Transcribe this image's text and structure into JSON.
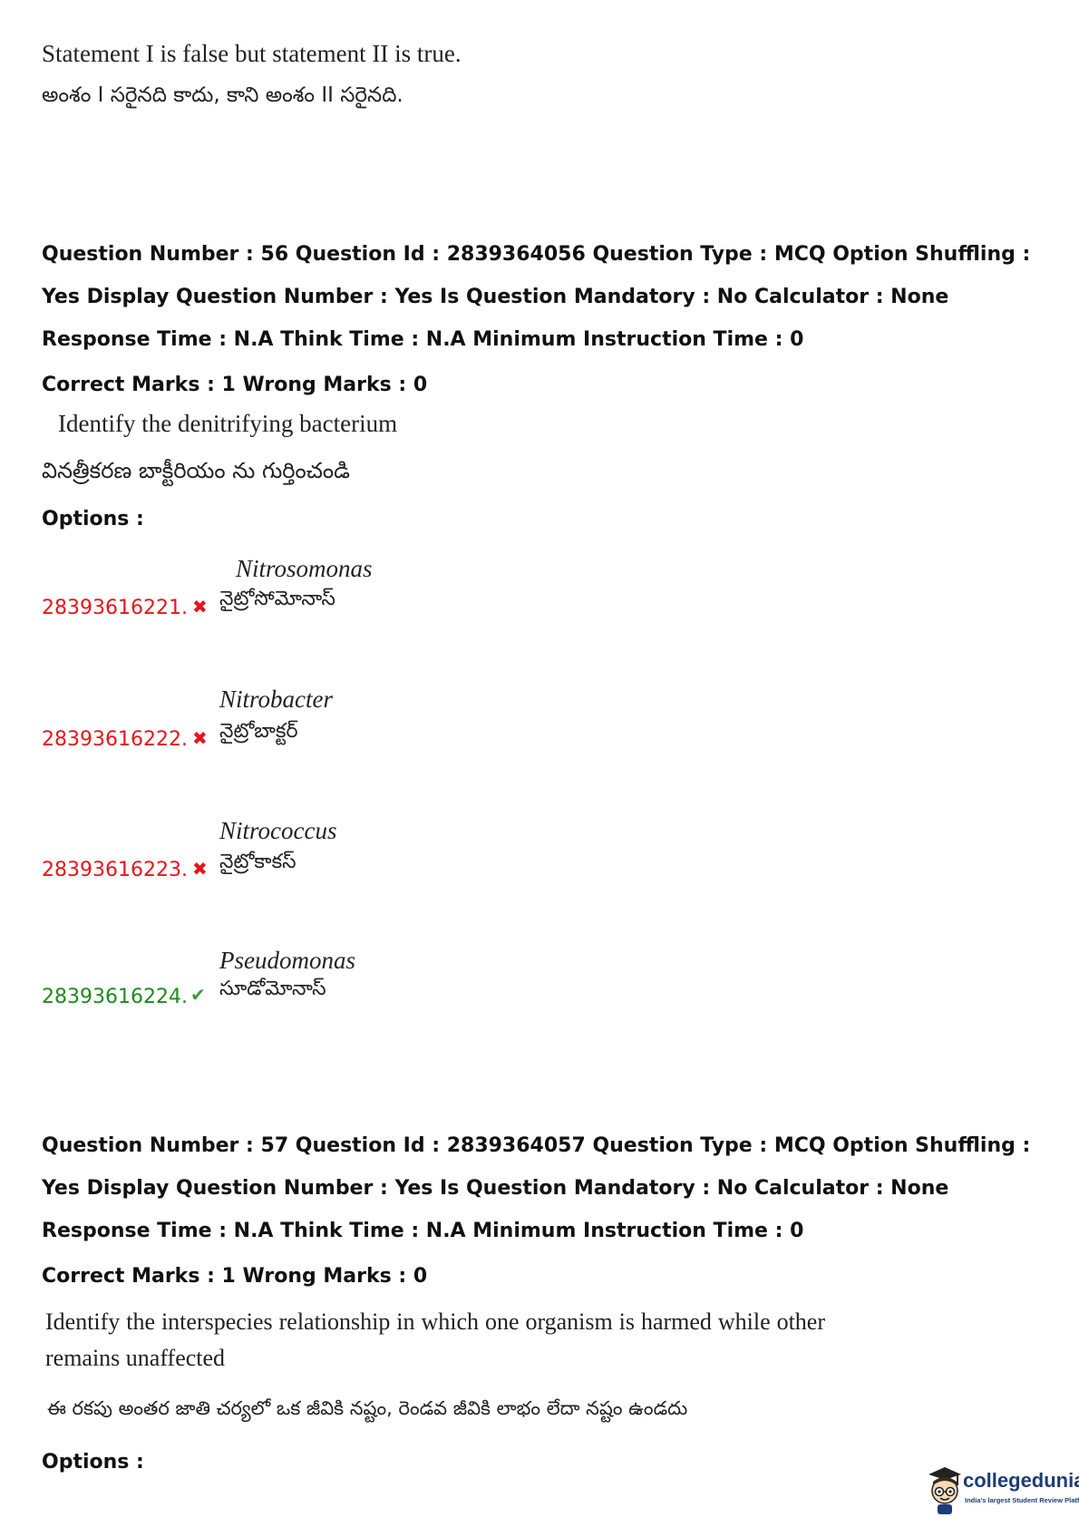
{
  "top_statement": {
    "english": "Statement I is false but statement II is true.",
    "telugu": "అంశం I సరైనది కాదు, కాని అంశం II సరైనది."
  },
  "q56": {
    "meta": "Question Number : 56 Question Id : 2839364056 Question Type : MCQ Option Shuffling : Yes Display Question Number : Yes Is Question Mandatory : No Calculator : None Response Time : N.A Think Time : N.A Minimum Instruction Time : 0",
    "marks": "Correct Marks : 1 Wrong Marks : 0",
    "question_english": "Identify the denitrifying bacterium",
    "question_telugu": "వినత్రీకరణ బాక్టీరియం ను గుర్తించండి",
    "options_label": "Options :",
    "options": [
      {
        "id": "28393616221.",
        "english": "Nitrosomonas",
        "telugu": "నైట్రోసోమోనాస్",
        "status": "wrong"
      },
      {
        "id": "28393616222.",
        "english": "Nitrobacter",
        "telugu": "నైట్రోబాక్టర్",
        "status": "wrong"
      },
      {
        "id": "28393616223.",
        "english": "Nitrococcus",
        "telugu": "నైట్రోకాకస్",
        "status": "wrong"
      },
      {
        "id": "28393616224.",
        "english": "Pseudomonas",
        "telugu": "సూడోమోనాస్",
        "status": "correct"
      }
    ]
  },
  "q57": {
    "meta": "Question Number : 57 Question Id : 2839364057 Question Type : MCQ Option Shuffling : Yes Display Question Number : Yes Is Question Mandatory : No Calculator : None Response Time : N.A Think Time : N.A Minimum Instruction Time : 0",
    "marks": "Correct Marks : 1 Wrong Marks : 0",
    "question_english": "Identify the interspecies relationship in which one organism is harmed while other remains unaffected",
    "question_telugu": "ఈ రకపు అంతర జాతి చర్యలో ఒక జీవికి నష్టం, రెండవ జీవికి లాభం లేదా నష్టం ఉండదు",
    "options_label": "Options :"
  },
  "icons": {
    "wrong": "✖",
    "correct": "✔"
  },
  "colors": {
    "wrong": "#e8141b",
    "correct": "#1f8a1f",
    "brand": "#1d3c78"
  },
  "logo": {
    "name": "collegedunia",
    "tagline": "India's largest Student Review Platform"
  }
}
